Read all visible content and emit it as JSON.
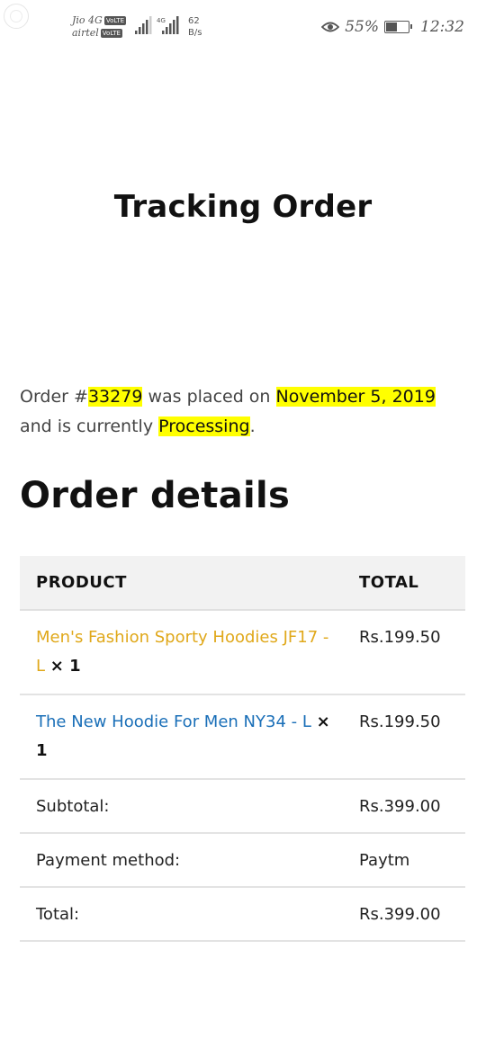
{
  "status_bar": {
    "carrier_1": "Jio 4G",
    "carrier_2": "airtel",
    "volte": "VoLTE",
    "network": "4G",
    "speed_value": "62",
    "speed_unit": "B/s",
    "battery_percent": "55%",
    "battery_level": 0.55,
    "time": "12:32"
  },
  "page": {
    "title": "Tracking Order"
  },
  "order": {
    "prefix": "Order #",
    "number": "33279",
    "placed_text": " was placed on ",
    "date": "November 5, 2019",
    "status_text": " and is currently ",
    "status": "Processing",
    "end": "."
  },
  "details": {
    "title": "Order details",
    "headers": {
      "product": "PRODUCT",
      "total": "TOTAL"
    },
    "items": [
      {
        "name": "Men's Fashion Sporty Hoodies JF17 - L",
        "qty": "× 1",
        "total": "Rs.199.50",
        "color": "#e0a81a"
      },
      {
        "name": "The New Hoodie For Men NY34 - L",
        "qty": "× 1",
        "total": "Rs.199.50",
        "color": "#1a6fb8"
      }
    ],
    "subtotal_label": "Subtotal:",
    "subtotal_value": "Rs.399.00",
    "payment_label": "Payment method:",
    "payment_value": "Paytm",
    "total_label": "Total:",
    "total_value": "Rs.399.00"
  }
}
